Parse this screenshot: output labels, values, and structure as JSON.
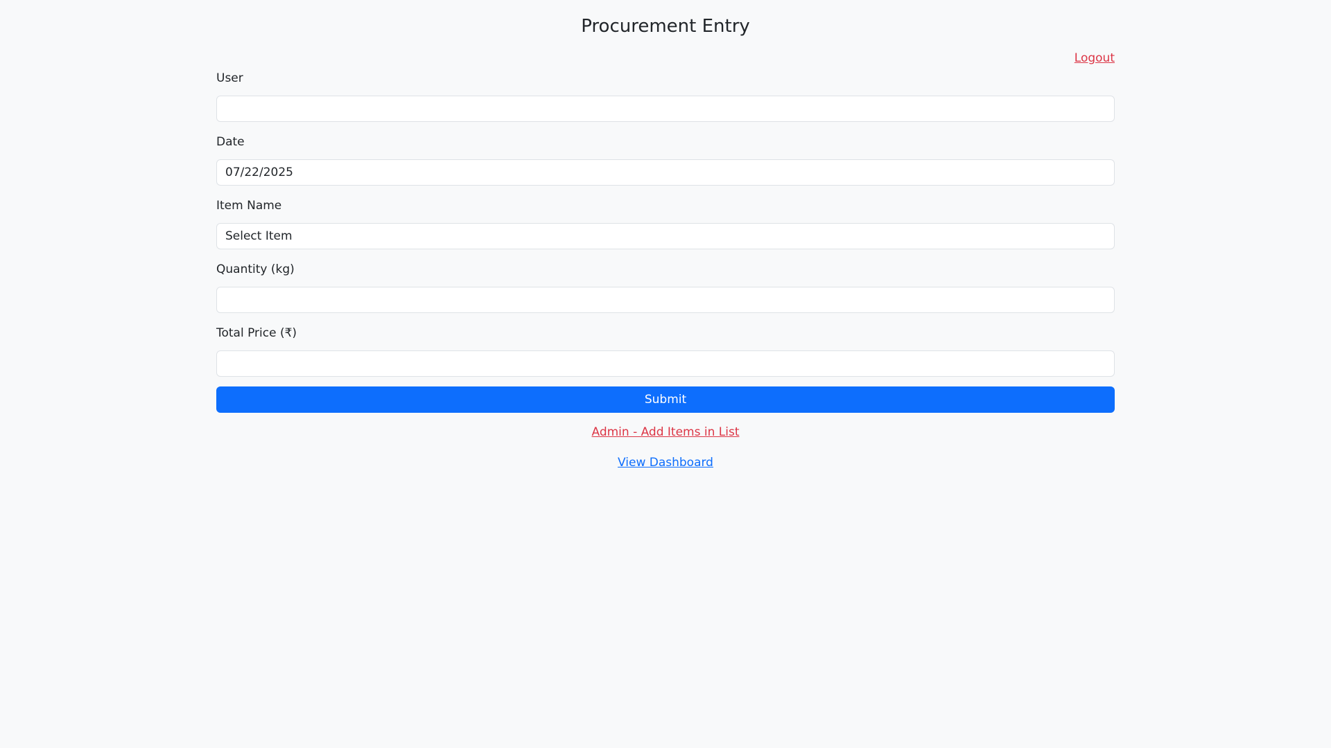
{
  "page": {
    "title": "Procurement Entry"
  },
  "nav": {
    "logout_label": "Logout"
  },
  "form": {
    "user": {
      "label": "User",
      "value": ""
    },
    "date": {
      "label": "Date",
      "value": "07/22/2025"
    },
    "item": {
      "label": "Item Name",
      "selected": "Select Item"
    },
    "quantity": {
      "label": "Quantity (kg)",
      "value": ""
    },
    "price": {
      "label": "Total Price (₹)",
      "value": ""
    },
    "submit_label": "Submit"
  },
  "links": {
    "admin_label": "Admin - Add Items in List",
    "dashboard_label": "View Dashboard"
  },
  "colors": {
    "primary": "#0d6efd",
    "danger": "#dc3545",
    "background": "#f8f9fa"
  }
}
